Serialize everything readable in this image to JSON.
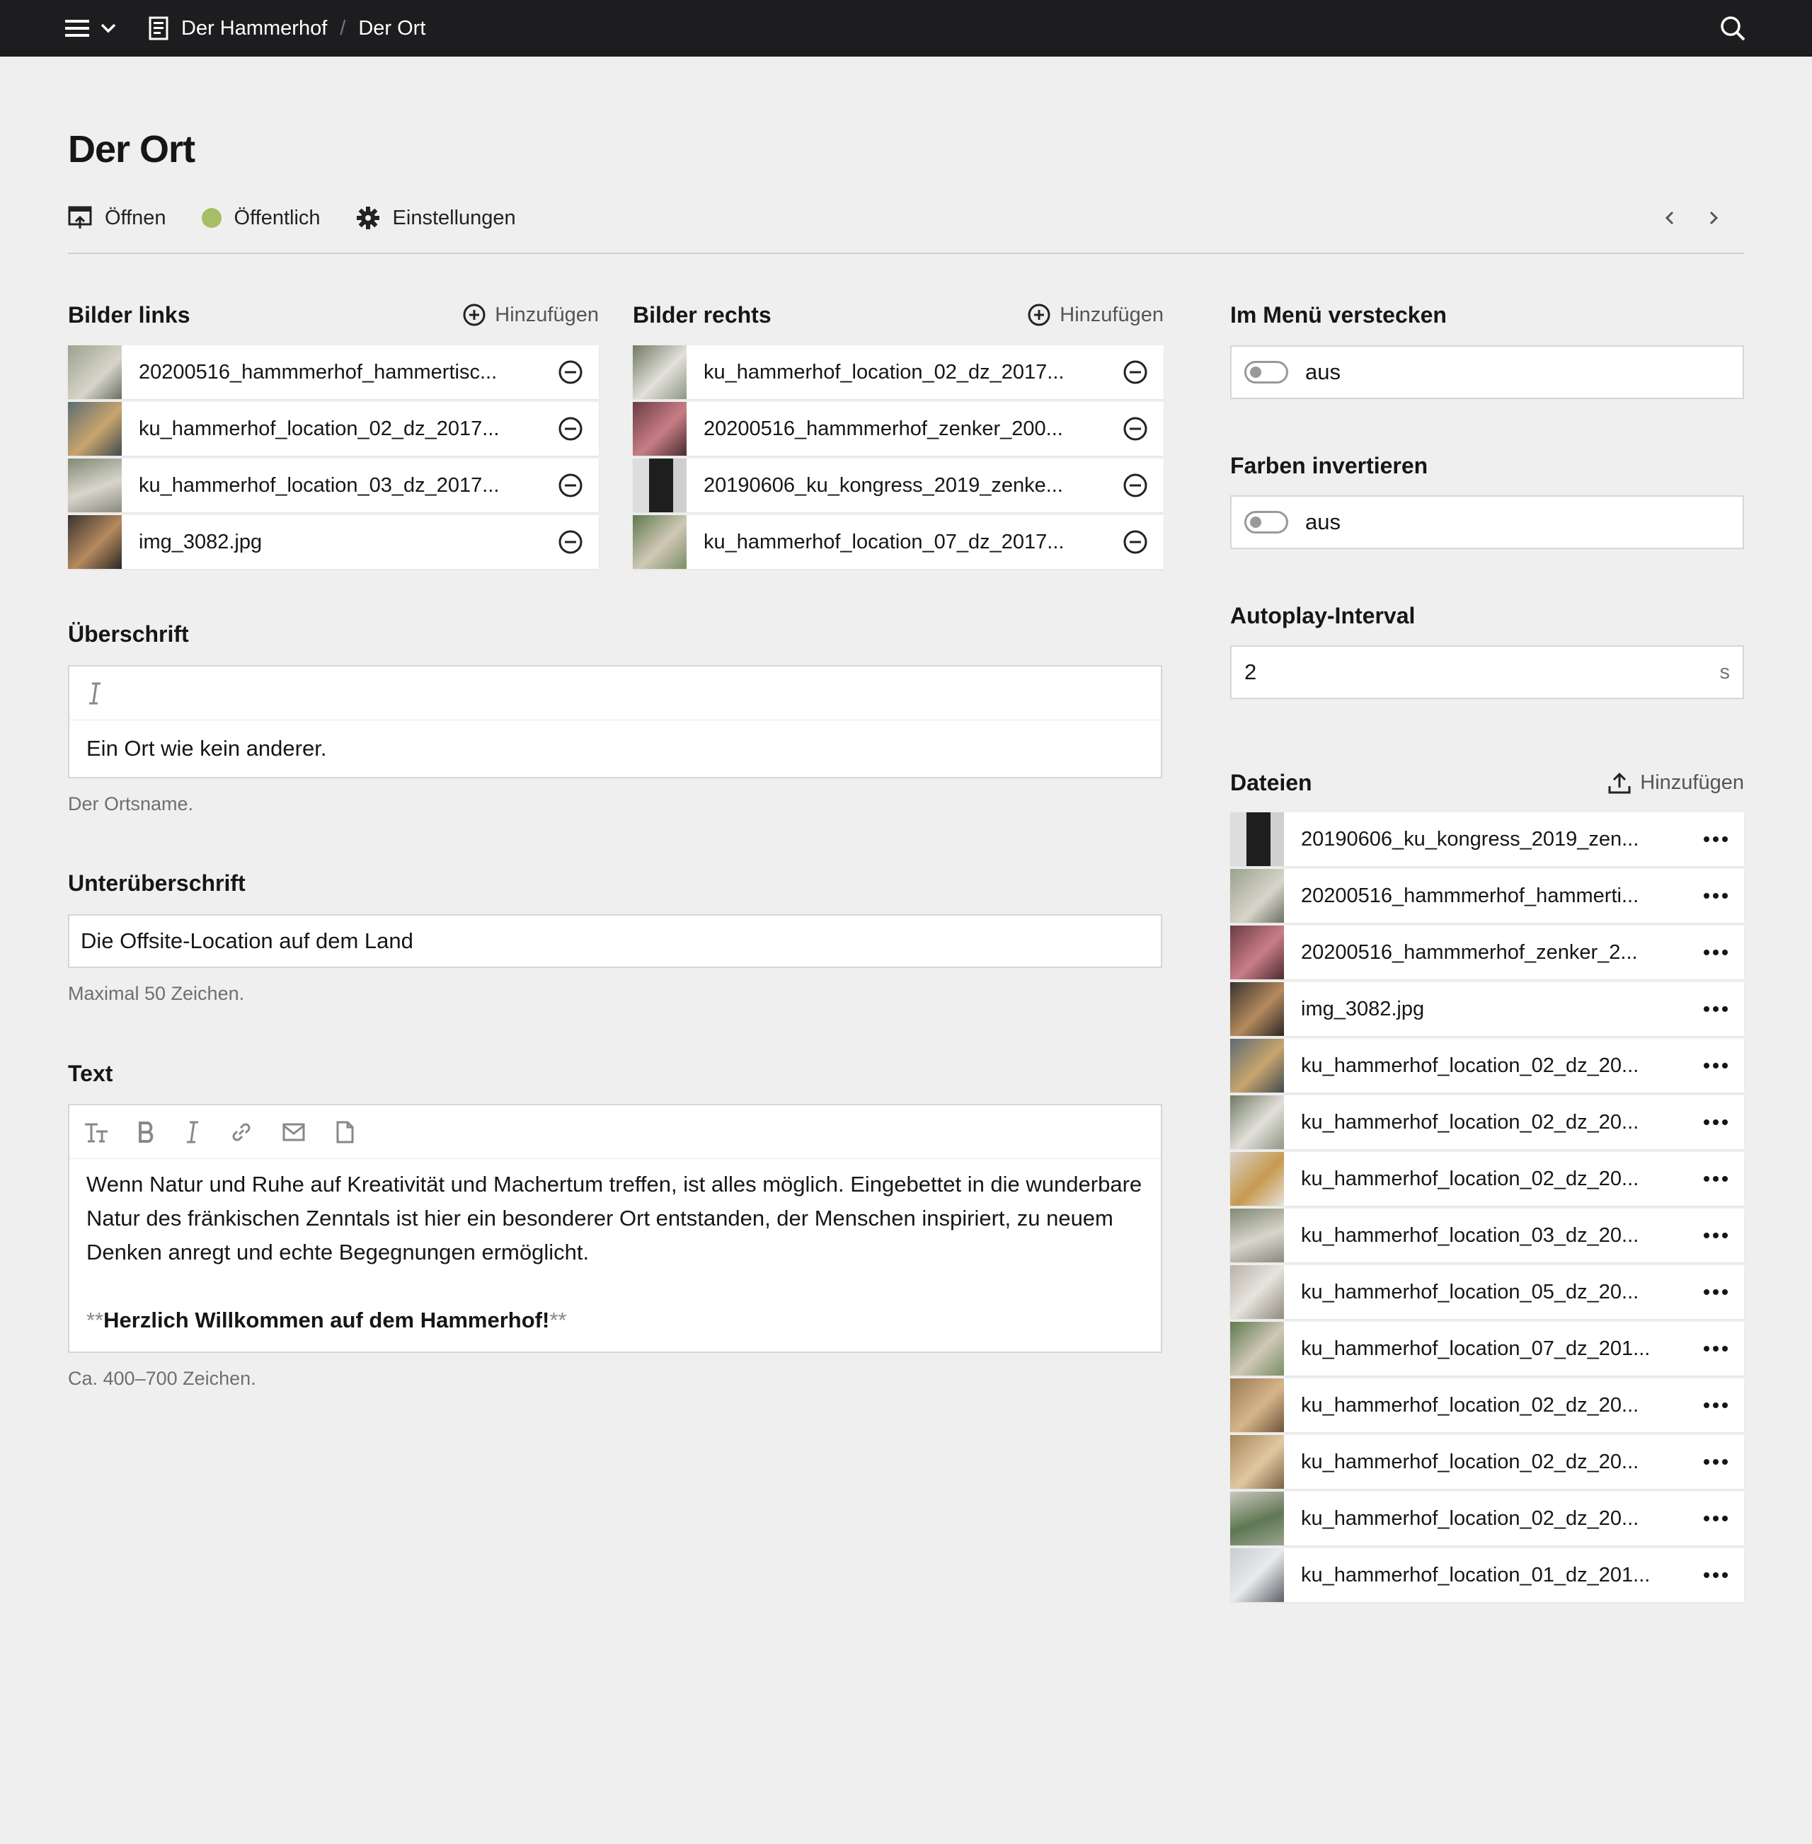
{
  "breadcrumb": {
    "site": "Der Hammerhof",
    "page": "Der Ort"
  },
  "page": {
    "title": "Der Ort",
    "open_label": "Öffnen",
    "status_label": "Öffentlich",
    "settings_label": "Einstellungen",
    "status_color": "#a7bd68"
  },
  "add_label": "Hinzufügen",
  "images_left": {
    "title": "Bilder links",
    "items": [
      {
        "name": "20200516_hammmerhof_hammertisc..."
      },
      {
        "name": "ku_hammerhof_location_02_dz_2017..."
      },
      {
        "name": "ku_hammerhof_location_03_dz_2017..."
      },
      {
        "name": "img_3082.jpg"
      }
    ]
  },
  "images_right": {
    "title": "Bilder rechts",
    "items": [
      {
        "name": "ku_hammerhof_location_02_dz_2017..."
      },
      {
        "name": "20200516_hammmerhof_zenker_200..."
      },
      {
        "name": "20190606_ku_kongress_2019_zenke..."
      },
      {
        "name": "ku_hammerhof_location_07_dz_2017..."
      }
    ]
  },
  "heading": {
    "label": "Überschrift",
    "value": "Ein Ort wie kein anderer.",
    "help": "Der Ortsname."
  },
  "subheading": {
    "label": "Unterüberschrift",
    "value": "Die Offsite-Location auf dem Land",
    "help": "Maximal 50 Zeichen."
  },
  "text": {
    "label": "Text",
    "paragraph": "Wenn Natur und Ruhe auf Kreativität und Machertum treffen, ist alles möglich. Eingebettet in die wunderbare Natur des fränkischen Zenntals ist hier ein besonderer Ort entstanden, der Menschen inspiriert, zu neuem Denken anregt und echte Begegnungen ermöglicht.",
    "stars": "**",
    "bold": "Herzlich Willkommen auf dem Hammerhof!",
    "help": "Ca. 400–700 Zeichen."
  },
  "hide_menu": {
    "label": "Im Menü verstecken",
    "value": "aus"
  },
  "invert": {
    "label": "Farben invertieren",
    "value": "aus"
  },
  "autoplay": {
    "label": "Autoplay-Interval",
    "value": "2",
    "unit": "s"
  },
  "files": {
    "title": "Dateien",
    "items": [
      {
        "name": "20190606_ku_kongress_2019_zen..."
      },
      {
        "name": "20200516_hammmerhof_hammerti..."
      },
      {
        "name": "20200516_hammmerhof_zenker_2..."
      },
      {
        "name": "img_3082.jpg"
      },
      {
        "name": "ku_hammerhof_location_02_dz_20..."
      },
      {
        "name": "ku_hammerhof_location_02_dz_20..."
      },
      {
        "name": "ku_hammerhof_location_02_dz_20..."
      },
      {
        "name": "ku_hammerhof_location_03_dz_20..."
      },
      {
        "name": "ku_hammerhof_location_05_dz_20..."
      },
      {
        "name": "ku_hammerhof_location_07_dz_201..."
      },
      {
        "name": "ku_hammerhof_location_02_dz_20..."
      },
      {
        "name": "ku_hammerhof_location_02_dz_20..."
      },
      {
        "name": "ku_hammerhof_location_02_dz_20..."
      },
      {
        "name": "ku_hammerhof_location_01_dz_201..."
      }
    ]
  }
}
